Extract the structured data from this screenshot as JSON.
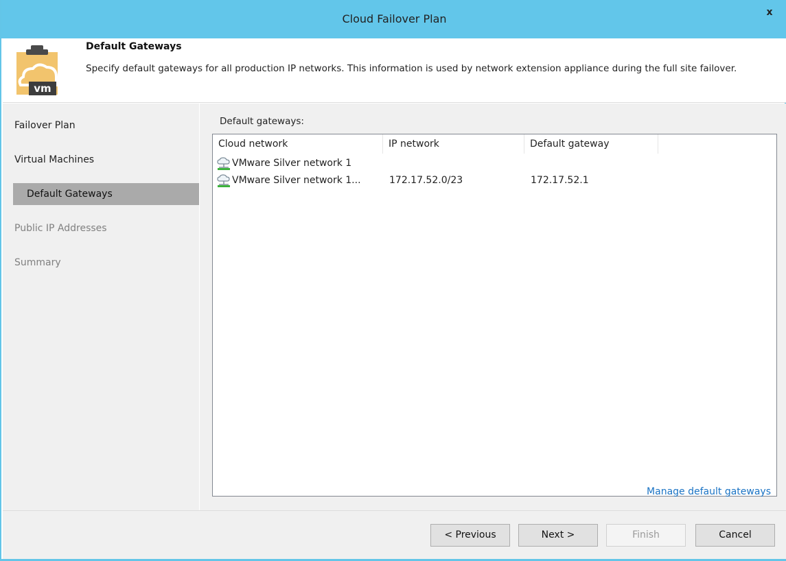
{
  "window": {
    "title": "Cloud Failover Plan",
    "close_label": "x"
  },
  "header": {
    "title": "Default Gateways",
    "description": "Specify default gateways for all production IP networks. This information is used by network extension appliance during the full site failover.",
    "icon": "vm-cloud-clipboard-icon",
    "icon_text": "vm"
  },
  "nav": {
    "items": [
      {
        "label": "Failover Plan",
        "state": "normal"
      },
      {
        "label": "Virtual Machines",
        "state": "normal"
      },
      {
        "label": "Default Gateways",
        "state": "active"
      },
      {
        "label": "Public IP Addresses",
        "state": "disabled"
      },
      {
        "label": "Summary",
        "state": "disabled"
      }
    ]
  },
  "content": {
    "label": "Default gateways:",
    "table": {
      "columns": [
        "Cloud network",
        "IP network",
        "Default gateway"
      ],
      "rows": [
        {
          "cloud_network": "VMware Silver network 1",
          "ip_network": "",
          "default_gateway": "",
          "icon": "network-icon"
        },
        {
          "cloud_network": "VMware Silver network 1...",
          "ip_network": "172.17.52.0/23",
          "default_gateway": "172.17.52.1",
          "icon": "network-icon"
        }
      ]
    },
    "manage_link": "Manage default gateways"
  },
  "footer": {
    "previous": "< Previous",
    "next": "Next >",
    "finish": "Finish",
    "cancel": "Cancel"
  },
  "colors": {
    "titlebar": "#62c6ea",
    "active_nav": "#aaaaaa",
    "link": "#1a73c4",
    "panel": "#f0f0f0"
  }
}
